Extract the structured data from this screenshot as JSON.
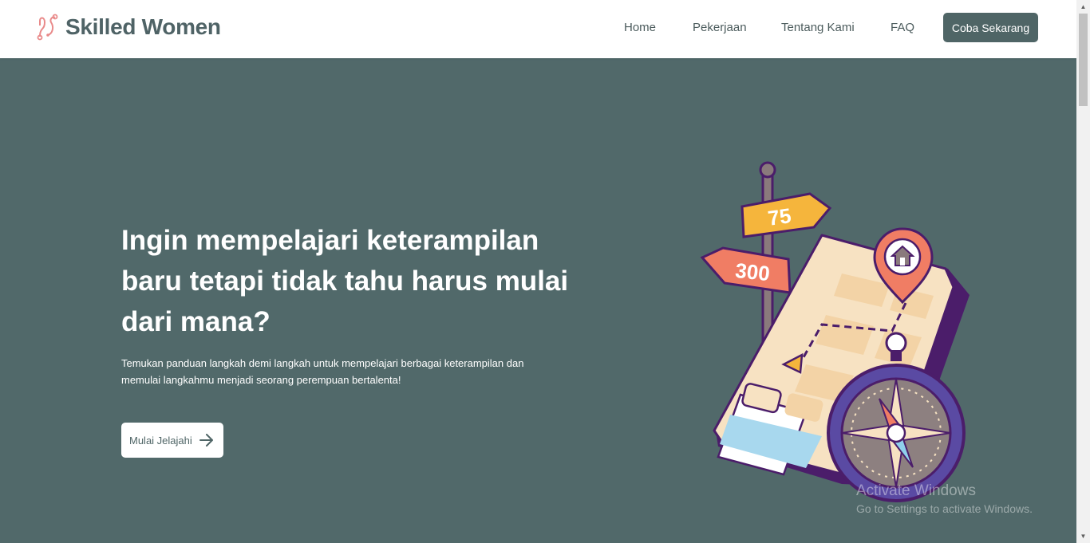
{
  "brand": {
    "name": "Skilled Women",
    "accent": "#4f6566",
    "logo_color": "#e98a8a"
  },
  "nav": {
    "links": [
      "Home",
      "Pekerjaan",
      "Tentang Kami",
      "FAQ"
    ],
    "cta_label": "Coba Sekarang"
  },
  "hero": {
    "title": "Ingin mempelajari keterampilan baru tetapi tidak tahu harus mulai dari mana?",
    "description": "Temukan panduan langkah demi langkah untuk mempelajari berbagai keterampilan dan memulai langkahmu menjadi seorang perempuan bertalenta!",
    "button_label": "Mulai Jelajahi",
    "background": "#51696a"
  },
  "illustration": {
    "sign_top": "75",
    "sign_bottom": "300"
  },
  "watermark": {
    "title": "Activate Windows",
    "subtitle": "Go to Settings to activate Windows."
  }
}
